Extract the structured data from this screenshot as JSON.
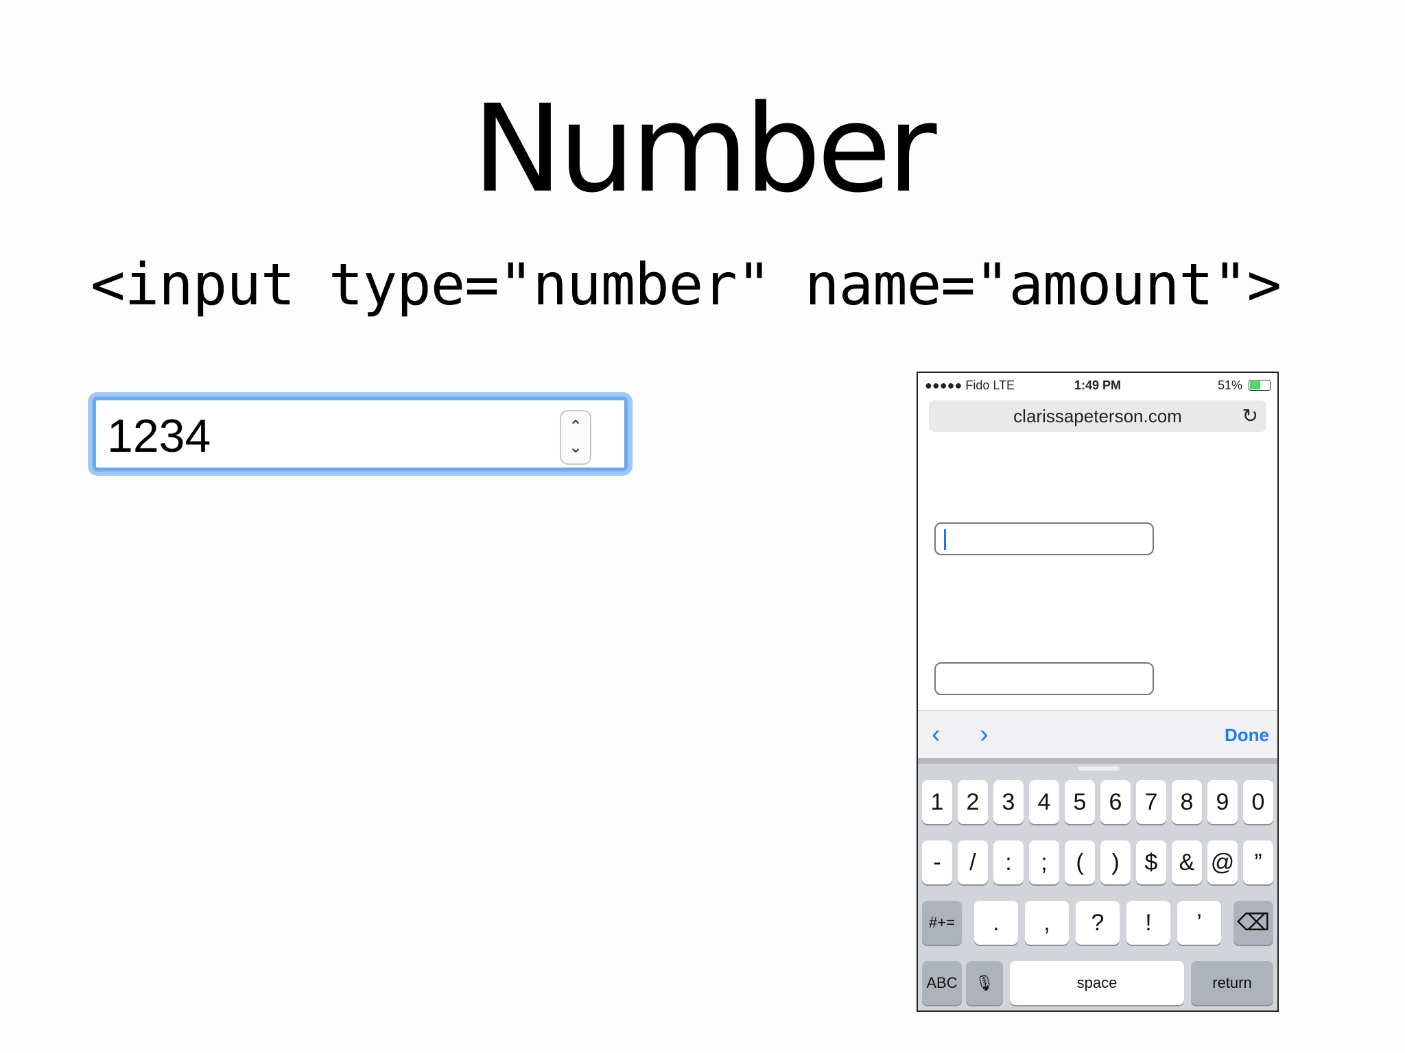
{
  "slide": {
    "title": "Number",
    "code": "<input type=\"number\" name=\"amount\">"
  },
  "desktop_input": {
    "value": "1234",
    "spinner_up": "⌃",
    "spinner_down": "⌄",
    "focus_color": "#7fb4ef"
  },
  "phone": {
    "status": {
      "carrier": "●●●●● Fido  LTE",
      "time": "1:49 PM",
      "battery": "51%"
    },
    "url": "clarissapeterson.com",
    "reload_icon": "↻",
    "accessory": {
      "prev_icon": "‹",
      "next_icon": "›",
      "done_label": "Done"
    },
    "keyboard": {
      "row1": [
        "1",
        "2",
        "3",
        "4",
        "5",
        "6",
        "7",
        "8",
        "9",
        "0"
      ],
      "row2": [
        "-",
        "/",
        ":",
        ";",
        "(",
        ")",
        "$",
        "&",
        "@",
        "”"
      ],
      "row3_left": "#+=",
      "row3": [
        ".",
        ",",
        "?",
        "!",
        "’"
      ],
      "delete_icon": "⌫",
      "abc": "ABC",
      "mic_icon": "🎙",
      "space": "space",
      "return": "return"
    }
  }
}
